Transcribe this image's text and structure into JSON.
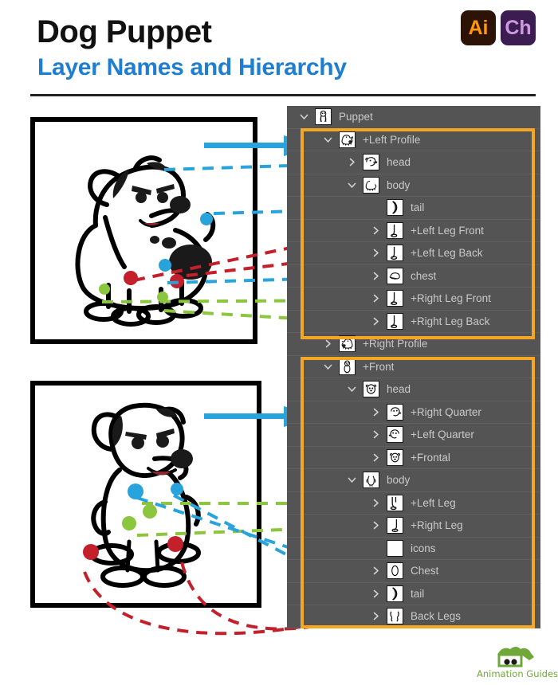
{
  "header": {
    "title": "Dog Puppet",
    "subtitle": "Layer Names and Hierarchy",
    "badges": [
      {
        "name": "illustrator-badge",
        "label": "Ai",
        "bg": "#2d1206",
        "fg": "#ff9a00"
      },
      {
        "name": "character-animator-badge",
        "label": "Ch",
        "bg": "#3b1d52",
        "fg": "#cd9ae0"
      }
    ]
  },
  "colors": {
    "panel_bg": "#545454",
    "row_divider": "#606060",
    "row_text": "#c9c9c9",
    "highlight": "#f5a623",
    "accent_blue": "#1f9ade",
    "title_blue": "#1f7ed0",
    "connector_red": "#c4202c",
    "connector_green": "#8cc63e",
    "connector_blue": "#29a3dc",
    "brand_green": "#6fa839"
  },
  "layers": [
    {
      "label": "Puppet",
      "depth": 0,
      "twisty": "chevron-down-icon",
      "thumb": "dog-full-thumb"
    },
    {
      "label": "+Left Profile",
      "depth": 1,
      "twisty": "chevron-down-icon",
      "thumb": "dog-left-profile-thumb"
    },
    {
      "label": "head",
      "depth": 2,
      "twisty": "chevron-right-icon",
      "thumb": "head-profile-thumb"
    },
    {
      "label": "body",
      "depth": 2,
      "twisty": "chevron-down-icon",
      "thumb": "body-profile-thumb"
    },
    {
      "label": "tail",
      "depth": 3,
      "twisty": "none",
      "thumb": "tail-thumb"
    },
    {
      "label": "+Left Leg Front",
      "depth": 3,
      "twisty": "chevron-right-icon",
      "thumb": "leg-thumb"
    },
    {
      "label": "+Left Leg Back",
      "depth": 3,
      "twisty": "chevron-right-icon",
      "thumb": "leg-thumb"
    },
    {
      "label": "chest",
      "depth": 3,
      "twisty": "chevron-right-icon",
      "thumb": "chest-profile-thumb"
    },
    {
      "label": "+Right Leg Front",
      "depth": 3,
      "twisty": "chevron-right-icon",
      "thumb": "leg-thumb"
    },
    {
      "label": "+Right Leg Back",
      "depth": 3,
      "twisty": "chevron-right-icon",
      "thumb": "leg-thumb"
    },
    {
      "label": "+Right Profile",
      "depth": 1,
      "twisty": "chevron-right-icon",
      "thumb": "dog-right-profile-thumb"
    },
    {
      "label": "+Front",
      "depth": 1,
      "twisty": "chevron-down-icon",
      "thumb": "dog-front-thumb"
    },
    {
      "label": "head",
      "depth": 2,
      "twisty": "chevron-down-icon",
      "thumb": "head-front-thumb"
    },
    {
      "label": "+Right Quarter",
      "depth": 3,
      "twisty": "chevron-right-icon",
      "thumb": "head-right-quarter-thumb"
    },
    {
      "label": "+Left Quarter",
      "depth": 3,
      "twisty": "chevron-right-icon",
      "thumb": "head-left-quarter-thumb"
    },
    {
      "label": "+Frontal",
      "depth": 3,
      "twisty": "chevron-right-icon",
      "thumb": "head-frontal-thumb"
    },
    {
      "label": "body",
      "depth": 2,
      "twisty": "chevron-down-icon",
      "thumb": "body-front-thumb"
    },
    {
      "label": "+Left Leg",
      "depth": 3,
      "twisty": "chevron-right-icon",
      "thumb": "leg-front-left-thumb"
    },
    {
      "label": "+Right Leg",
      "depth": 3,
      "twisty": "chevron-right-icon",
      "thumb": "leg-front-right-thumb"
    },
    {
      "label": "icons",
      "depth": 3,
      "twisty": "none",
      "thumb": "empty-thumb"
    },
    {
      "label": "Chest",
      "depth": 3,
      "twisty": "chevron-right-icon",
      "thumb": "chest-front-thumb"
    },
    {
      "label": "tail",
      "depth": 3,
      "twisty": "chevron-right-icon",
      "thumb": "tail-thumb"
    },
    {
      "label": "Back Legs",
      "depth": 3,
      "twisty": "chevron-right-icon",
      "thumb": "back-legs-thumb"
    }
  ],
  "illustrations": {
    "profile": {
      "name": "dog-left-profile-illustration",
      "markers": [
        {
          "color": "#29a3dc",
          "label": "tail-marker"
        },
        {
          "color": "#c4202c",
          "label": "left-leg-front-marker"
        },
        {
          "color": "#c4202c",
          "label": "left-leg-back-marker"
        },
        {
          "color": "#29a3dc",
          "label": "chest-marker"
        },
        {
          "color": "#8cc63e",
          "label": "right-leg-front-marker"
        },
        {
          "color": "#8cc63e",
          "label": "right-leg-back-marker"
        }
      ]
    },
    "front": {
      "name": "dog-front-illustration",
      "markers": [
        {
          "color": "#29a3dc",
          "label": "chest-marker"
        },
        {
          "color": "#29a3dc",
          "label": "tail-marker"
        },
        {
          "color": "#8cc63e",
          "label": "left-leg-marker"
        },
        {
          "color": "#8cc63e",
          "label": "right-leg-marker"
        },
        {
          "color": "#c4202c",
          "label": "back-leg-left-marker"
        },
        {
          "color": "#c4202c",
          "label": "back-leg-right-marker"
        }
      ]
    }
  },
  "footer": {
    "brand": "Animation Guides"
  }
}
